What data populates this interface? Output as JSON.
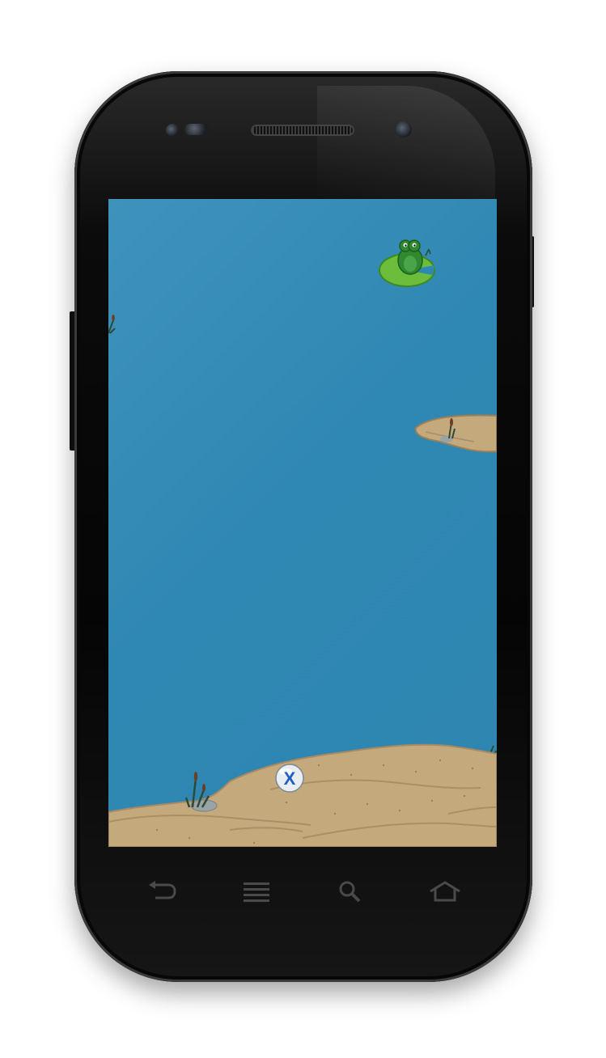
{
  "device": {
    "model_style": "android-phone"
  },
  "game": {
    "colors": {
      "water": "#2f88b3",
      "sand": "#c4a97d",
      "lily_pad": "#5fb336",
      "frog": "#2f8a2f"
    },
    "sprites": {
      "frog": "frog-on-lily-pad",
      "ball": "x-ball",
      "ball_label": "X"
    }
  },
  "navigation": {
    "keys": [
      {
        "icon": "back-icon"
      },
      {
        "icon": "menu-icon"
      },
      {
        "icon": "search-icon"
      },
      {
        "icon": "home-icon"
      }
    ]
  }
}
